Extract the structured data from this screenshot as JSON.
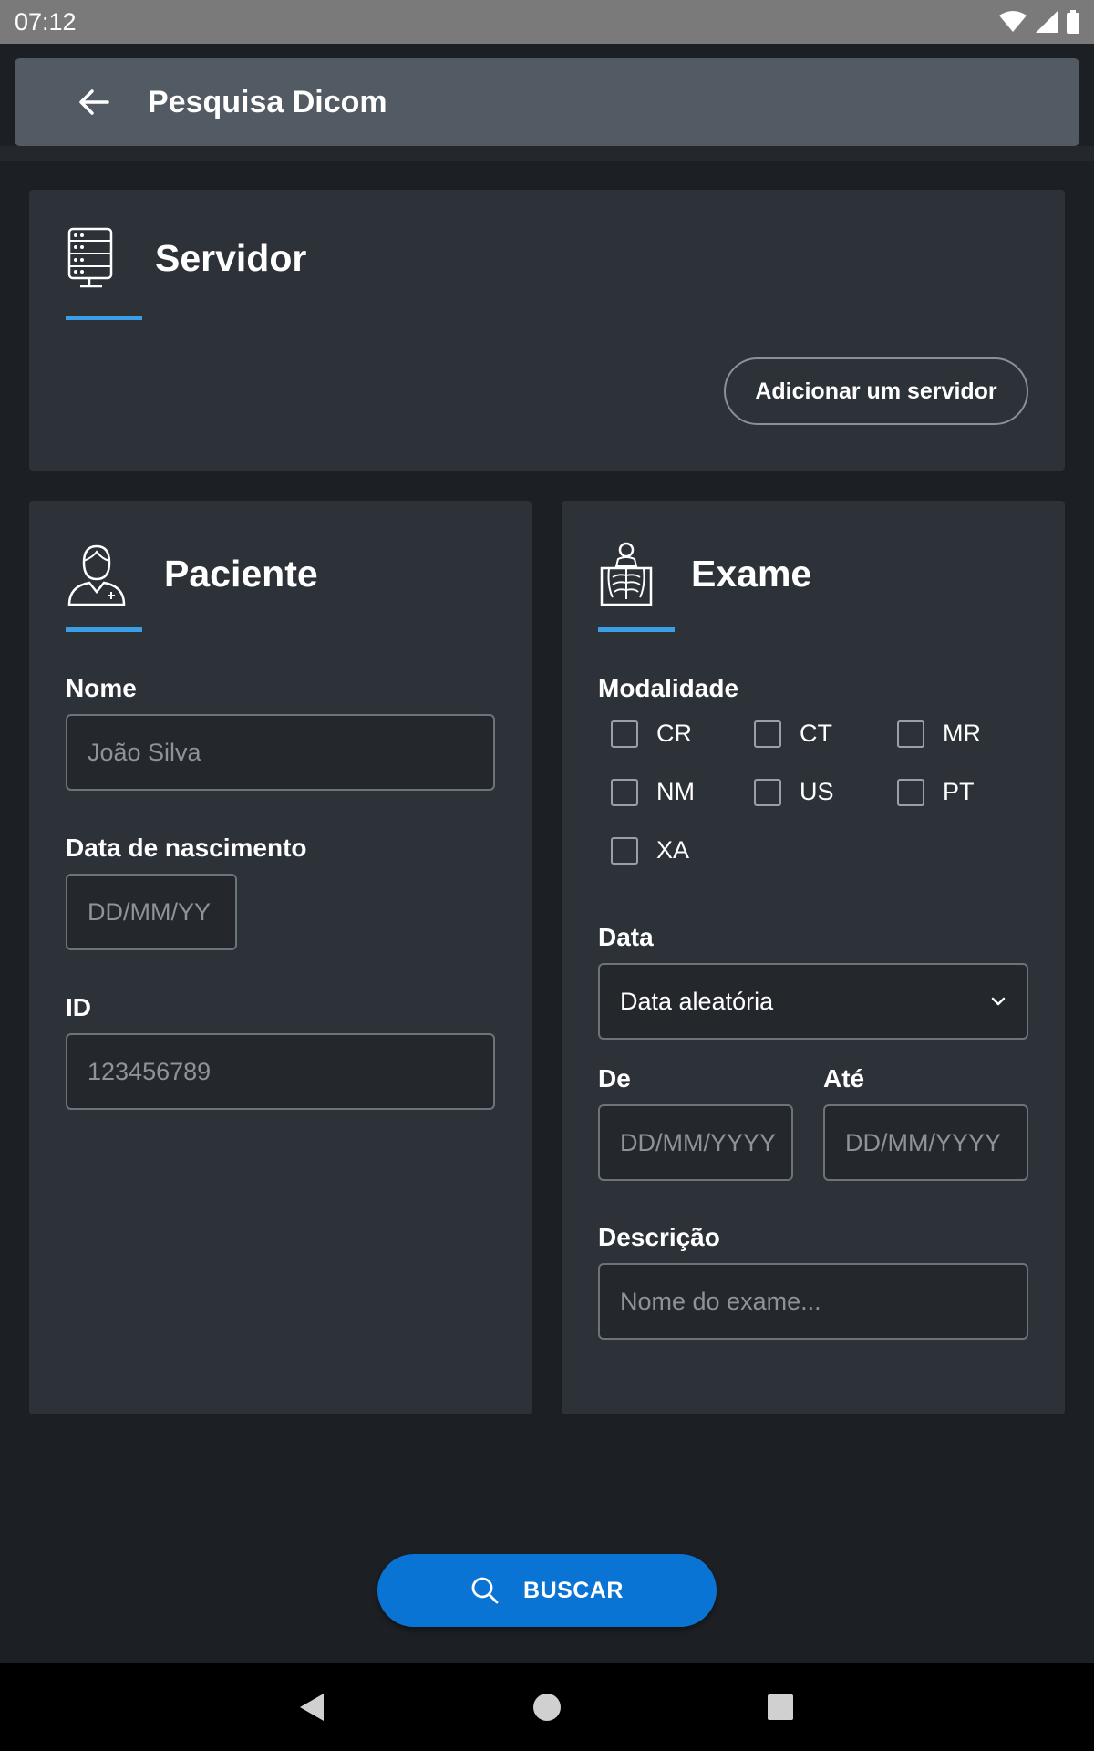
{
  "status_bar": {
    "time": "07:12"
  },
  "app_bar": {
    "title": "Pesquisa Dicom",
    "back_icon": "arrow-back-icon"
  },
  "server": {
    "title": "Servidor",
    "icon": "server-icon",
    "add_button_label": "Adicionar um servidor"
  },
  "patient": {
    "title": "Paciente",
    "icon": "doctor-icon",
    "name_label": "Nome",
    "name_placeholder": "João Silva",
    "birth_label": "Data de nascimento",
    "birth_placeholder": "DD/MM/YY",
    "id_label": "ID",
    "id_placeholder": "123456789"
  },
  "exam": {
    "title": "Exame",
    "icon": "xray-icon",
    "modality_label": "Modalidade",
    "modalities": [
      "CR",
      "CT",
      "MR",
      "NM",
      "US",
      "PT",
      "XA"
    ],
    "date_label": "Data",
    "date_selected": "Data aleatória",
    "from_label": "De",
    "from_placeholder": "DD/MM/YYYY",
    "to_label": "Até",
    "to_placeholder": "DD/MM/YYYY",
    "description_label": "Descrição",
    "description_placeholder": "Nome do exame..."
  },
  "search_button": {
    "label": "BUSCAR",
    "icon": "search-icon"
  },
  "colors": {
    "accent": "#3a9fe6",
    "primary_button": "#0a74d4",
    "card_bg": "#2d3238",
    "page_bg": "#1c1f23"
  }
}
